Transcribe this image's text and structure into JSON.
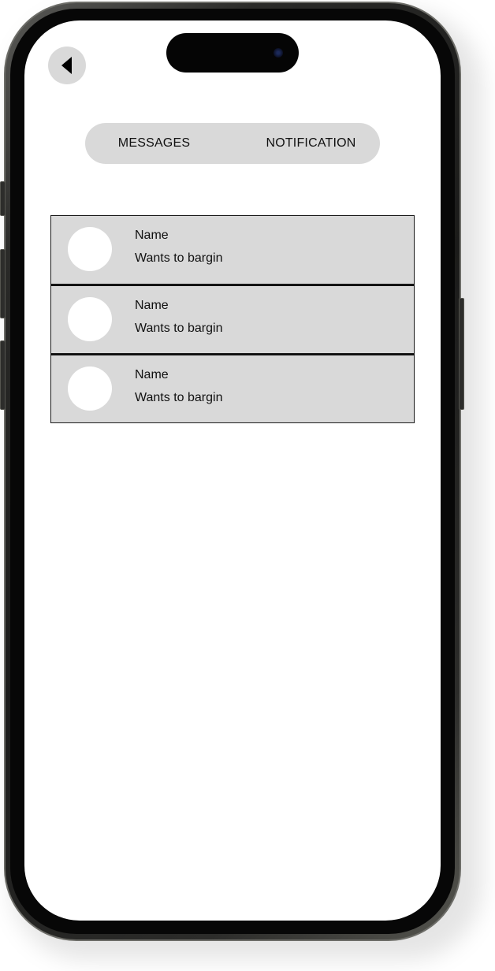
{
  "header": {
    "back_icon": "back-arrow-icon"
  },
  "tabs": [
    {
      "label": "MESSAGES"
    },
    {
      "label": "NOTIFICATION"
    }
  ],
  "notifications": [
    {
      "name": "Name",
      "message": "Wants to bargin"
    },
    {
      "name": "Name",
      "message": "Wants to bargin"
    },
    {
      "name": "Name",
      "message": "Wants to bargin"
    }
  ],
  "colors": {
    "surface": "#d9d9d9",
    "avatar": "#ffffff",
    "text": "#111111",
    "screen": "#ffffff"
  }
}
